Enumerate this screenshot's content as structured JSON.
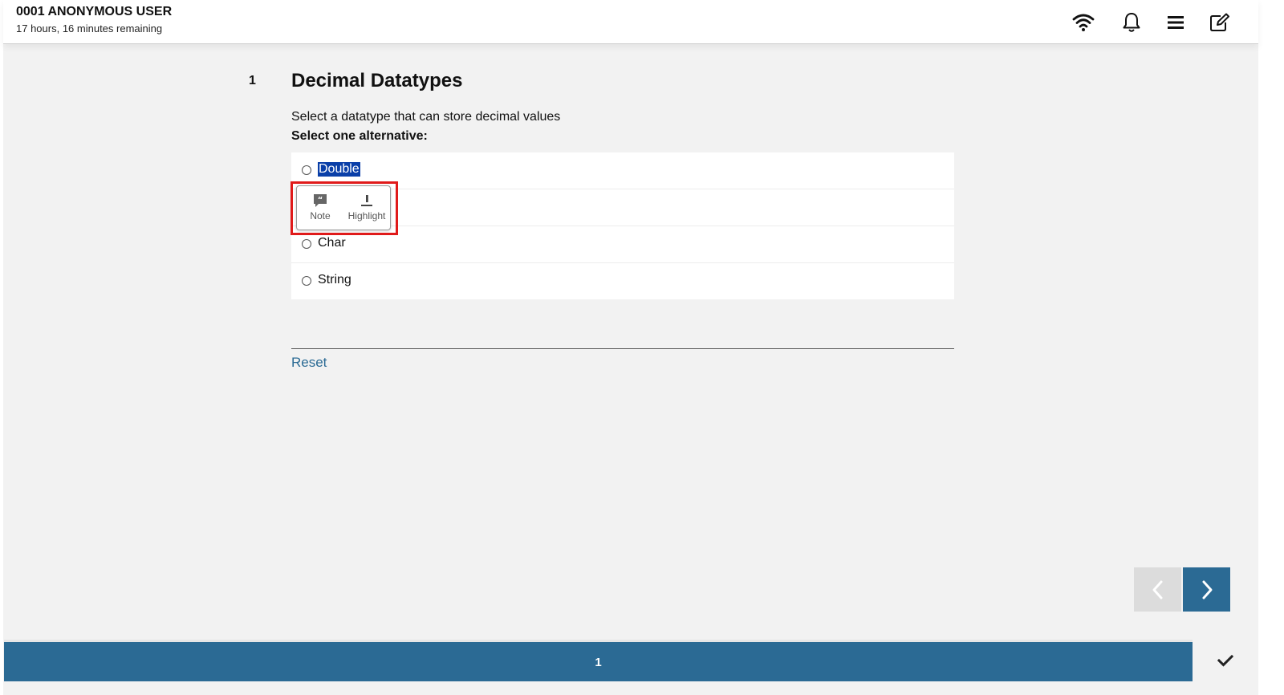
{
  "header": {
    "user_name": "0001 ANONYMOUS USER",
    "time_remaining": "17 hours, 16 minutes remaining",
    "icons": [
      "wifi-icon",
      "bell-icon",
      "menu-icon",
      "edit-icon"
    ]
  },
  "question": {
    "number": "1",
    "title": "Decimal Datatypes",
    "text": "Select a datatype that can store decimal values",
    "instruction": "Select one alternative:",
    "options": [
      {
        "label": "Double",
        "selected_text": true
      },
      {
        "label": ""
      },
      {
        "label": "Char"
      },
      {
        "label": "String"
      }
    ],
    "reset_label": "Reset"
  },
  "selection_popup": {
    "note_label": "Note",
    "highlight_label": "Highlight"
  },
  "navigation": {
    "prev_icon": "chevron-left-icon",
    "next_icon": "chevron-right-icon"
  },
  "footer": {
    "current_page": "1",
    "check_icon": "checkmark-icon"
  },
  "colors": {
    "accent": "#2b6a94",
    "selection": "#0a3fa8",
    "outline": "#e01a1a",
    "background": "#f2f2f2"
  }
}
